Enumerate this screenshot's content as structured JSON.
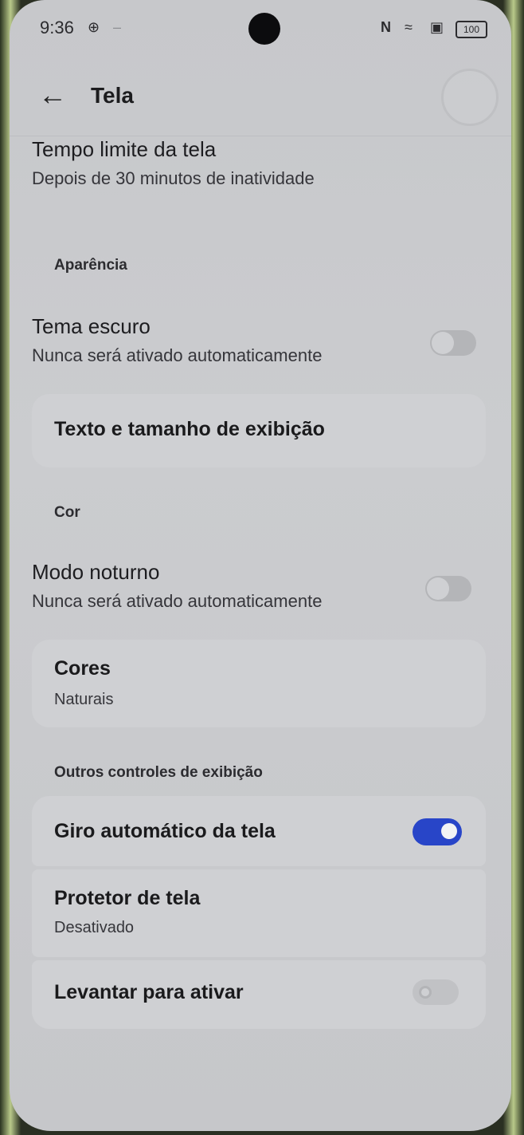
{
  "status_bar": {
    "time": "9:36",
    "battery": "100"
  },
  "app_bar": {
    "title": "Tela"
  },
  "screen_timeout": {
    "title": "Tempo limite da tela",
    "subtitle": "Depois de 30 minutos de inatividade"
  },
  "sections": {
    "appearance": "Aparência",
    "color": "Cor",
    "other": "Outros controles de exibição"
  },
  "dark_theme": {
    "title": "Tema escuro",
    "subtitle": "Nunca será ativado automaticamente",
    "enabled": false
  },
  "text_size": {
    "title": "Texto e tamanho de exibição"
  },
  "night_mode": {
    "title": "Modo noturno",
    "subtitle": "Nunca será ativado automaticamente",
    "enabled": false
  },
  "colors": {
    "title": "Cores",
    "subtitle": "Naturais"
  },
  "auto_rotate": {
    "title": "Giro automático da tela",
    "enabled": true
  },
  "screensaver": {
    "title": "Protetor de tela",
    "subtitle": "Desativado"
  },
  "lift_to_wake": {
    "title": "Levantar para ativar",
    "enabled": false,
    "disabled": true
  },
  "colors_palette": {
    "accent": "#2845c8",
    "background": "#c9cacd"
  }
}
